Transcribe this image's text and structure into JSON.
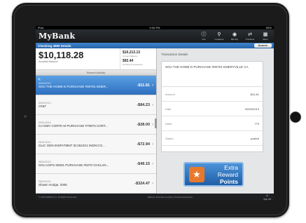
{
  "status_bar": {
    "carrier": "iPad",
    "time": "9:06 PM",
    "battery": "85%"
  },
  "header": {
    "logo": "MyBank",
    "nav": [
      {
        "label": "Info",
        "icon": "info-icon"
      },
      {
        "label": "Locations",
        "icon": "location-pin-icon"
      },
      {
        "label": "Bill Pay",
        "icon": "bill-pay-icon"
      },
      {
        "label": "Transfers",
        "icon": "transfer-icon"
      },
      {
        "label": "Menu",
        "icon": "grid-icon"
      }
    ]
  },
  "subheader": {
    "title": "Checking 4990 Details",
    "search_label": "Search"
  },
  "account": {
    "available_balance": "$10,118.28",
    "available_label": "Available Balance",
    "current_balance": "$10,213.13",
    "current_label": "Current Balance",
    "pending": "$92.44",
    "pending_label": "Pending Transactions"
  },
  "recent_activity_label": "Recent Activity",
  "transactions": [
    {
      "date": "09/03/2013",
      "desc": "SOU THE HOME D PURCHASE #00761 EMER...",
      "amount": "-$11.81",
      "selected": true
    },
    {
      "date": "09/02/2013",
      "desc": "AT&T",
      "amount": "-$84.23",
      "selected": false
    },
    {
      "date": "09/01/2013",
      "desc": "CA DMV CORTE M PURCHASE #70875 CORT...",
      "amount": "-$28.00",
      "selected": false
    },
    {
      "date": "08/31/2013",
      "desc": "GLIC GEN-INSPATMNT ID:2624X1 INDN:CO...",
      "amount": "-$72.94",
      "selected": false
    },
    {
      "date": "08/30/2013",
      "desc": "SOU USPS 05501 PURCHASE #0270 OAKLAN...",
      "amount": "-$49.15",
      "selected": false
    },
    {
      "date": "08/29/2013",
      "desc": "Shawn Hodge, 2005",
      "amount": "-$324.47",
      "selected": false
    }
  ],
  "details": {
    "title": "Transaction Details",
    "header_text": "SOU THE HOME D PURCHASE #00761 EMERYVILLE CA",
    "rows": [
      {
        "label": "Amount",
        "value": "-$11.81"
      },
      {
        "label": "Date",
        "value": "09/03/2013"
      },
      {
        "label": "Debit",
        "value": "779"
      },
      {
        "label": "Status",
        "value": "posted"
      }
    ]
  },
  "promo": {
    "line1": "Extra Reward",
    "line2": "Points"
  },
  "footer": {
    "copyright": "© 2013 MyBank Inc. All Rights Reserved.",
    "right_text": "Balance Accurate Courtesy Checkout Enterprise",
    "signout": "Sign Off"
  }
}
